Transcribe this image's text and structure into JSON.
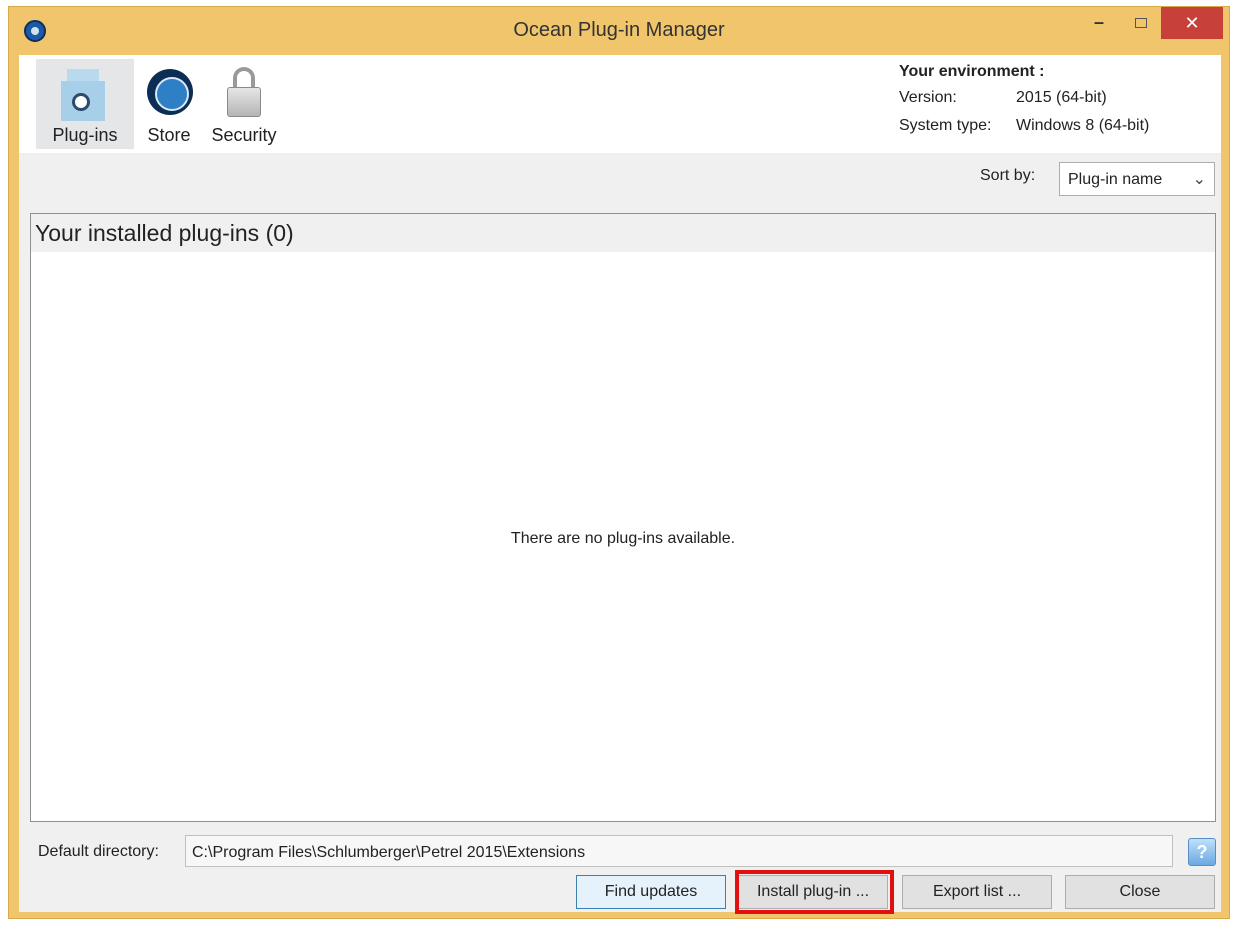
{
  "window": {
    "title": "Ocean Plug-in Manager",
    "close_glyph": "✕",
    "minimize_glyph": "–"
  },
  "toolbar": {
    "items": [
      {
        "label": "Plug-ins",
        "icon": "plugin-icon",
        "selected": true
      },
      {
        "label": "Store",
        "icon": "ocean-store-icon",
        "selected": false
      },
      {
        "label": "Security",
        "icon": "lock-icon",
        "selected": false
      }
    ]
  },
  "environment": {
    "heading": "Your environment :",
    "rows": [
      {
        "key": "Version:",
        "value": "2015 (64-bit)"
      },
      {
        "key": "System type:",
        "value": "Windows 8 (64-bit)"
      }
    ]
  },
  "sort": {
    "label": "Sort by:",
    "selected": "Plug-in name"
  },
  "plugin_list": {
    "header": "Your installed plug-ins (0)",
    "empty_message": "There are no plug-ins available."
  },
  "directory": {
    "label": "Default directory:",
    "value": "C:\\Program Files\\Schlumberger\\Petrel 2015\\Extensions",
    "help_glyph": "?"
  },
  "buttons": {
    "find_updates": "Find updates",
    "install": "Install plug-in ...",
    "export": "Export list ...",
    "close": "Close"
  },
  "colors": {
    "title_bar": "#f0c56c",
    "close_button": "#c7403a",
    "highlight_box": "#e01010"
  }
}
